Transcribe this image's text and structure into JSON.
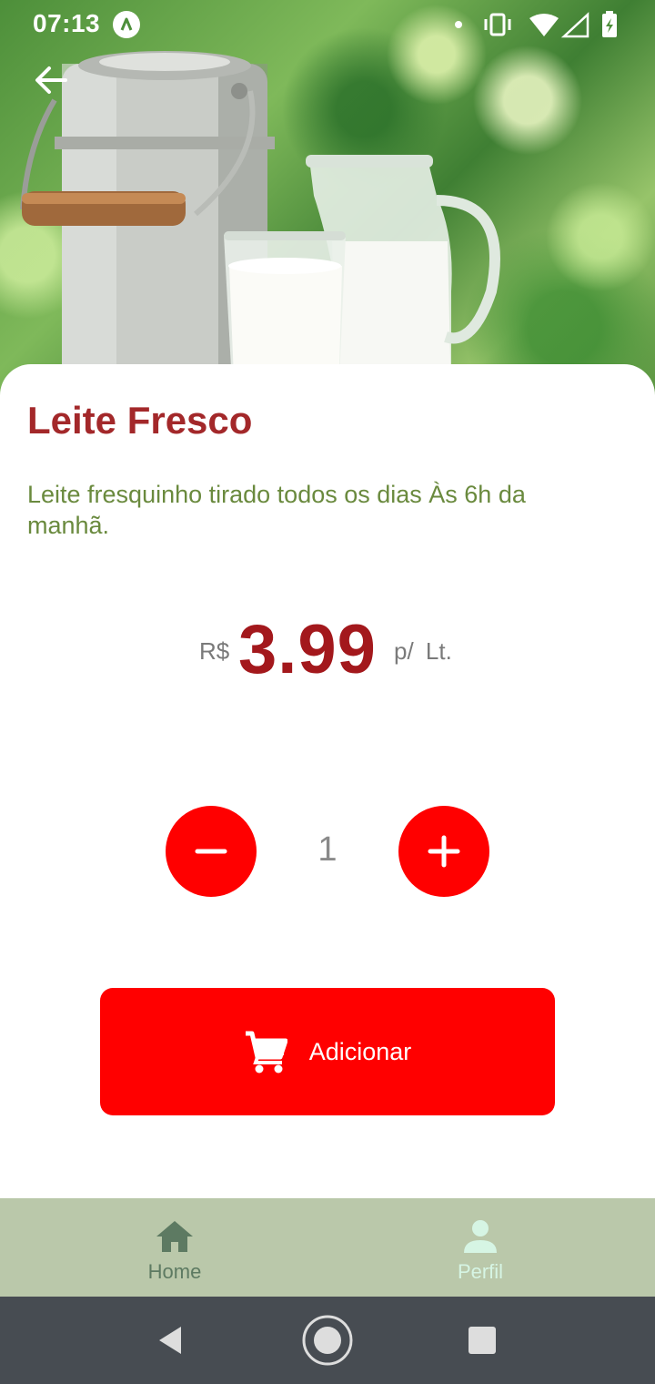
{
  "status_bar": {
    "time": "07:13"
  },
  "product": {
    "name": "Leite Fresco",
    "description": "Leite fresquinho tirado todos os dias Às 6h da manhã.",
    "currency": "R$",
    "price": "3.99",
    "unit": "p/ Lt."
  },
  "quantity": {
    "value": "1"
  },
  "actions": {
    "add_label": "Adicionar"
  },
  "bottom_nav": {
    "items": [
      {
        "label": "Home",
        "icon": "home-icon",
        "active": false
      },
      {
        "label": "Perfil",
        "icon": "person-icon",
        "active": true
      }
    ]
  },
  "colors": {
    "title": "#a3282a",
    "description": "#6a8a3e",
    "price": "#a3181c",
    "accent": "#ff0000",
    "bottom_nav_bg": "#bac8aa",
    "nav_active": "#d6f5e4",
    "nav_inactive": "#5d7a62",
    "system_nav_bg": "#474c52"
  }
}
